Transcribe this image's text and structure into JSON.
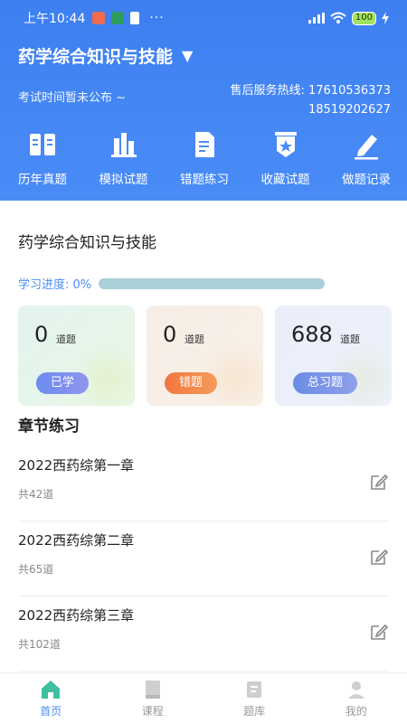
{
  "status_bar": {
    "time": "上午10:44",
    "dots": "···",
    "battery": "100"
  },
  "header": {
    "title": "药学综合知识与技能",
    "caret": "▼",
    "exam_time": "考试时间暂未公布 ~",
    "hotline_label": "售后服务热线: 17610536373",
    "hotline_second": "18519202627",
    "background_color": "#4a8cf6"
  },
  "menu": [
    {
      "label": "历年真题",
      "icon": "book-open-icon"
    },
    {
      "label": "模拟试题",
      "icon": "buildings-icon"
    },
    {
      "label": "错题练习",
      "icon": "document-icon"
    },
    {
      "label": "收藏试题",
      "icon": "star-badge-icon"
    },
    {
      "label": "做题记录",
      "icon": "pencil-icon"
    }
  ],
  "main": {
    "course_name": "药学综合知识与技能",
    "progress_label": "学习进度: 0%",
    "progress_value": 0
  },
  "cards": [
    {
      "value": "0",
      "unit": "道题",
      "tag": "已学"
    },
    {
      "value": "0",
      "unit": "道题",
      "tag": "错题"
    },
    {
      "value": "688",
      "unit": "道题",
      "tag": "总习题"
    }
  ],
  "chapters_section": {
    "title": "章节练习",
    "items": [
      {
        "name": "2022西药综第一章",
        "count": "共42道"
      },
      {
        "name": "2022西药综第二章",
        "count": "共65道"
      },
      {
        "name": "2022西药综第三章",
        "count": "共102道"
      }
    ]
  },
  "bottom_nav": {
    "items": [
      {
        "label": "首页",
        "icon": "home-icon",
        "active": true
      },
      {
        "label": "课程",
        "icon": "course-book-icon",
        "active": false
      },
      {
        "label": "题库",
        "icon": "question-bank-icon",
        "active": false
      },
      {
        "label": "我的",
        "icon": "user-icon",
        "active": false
      }
    ]
  }
}
